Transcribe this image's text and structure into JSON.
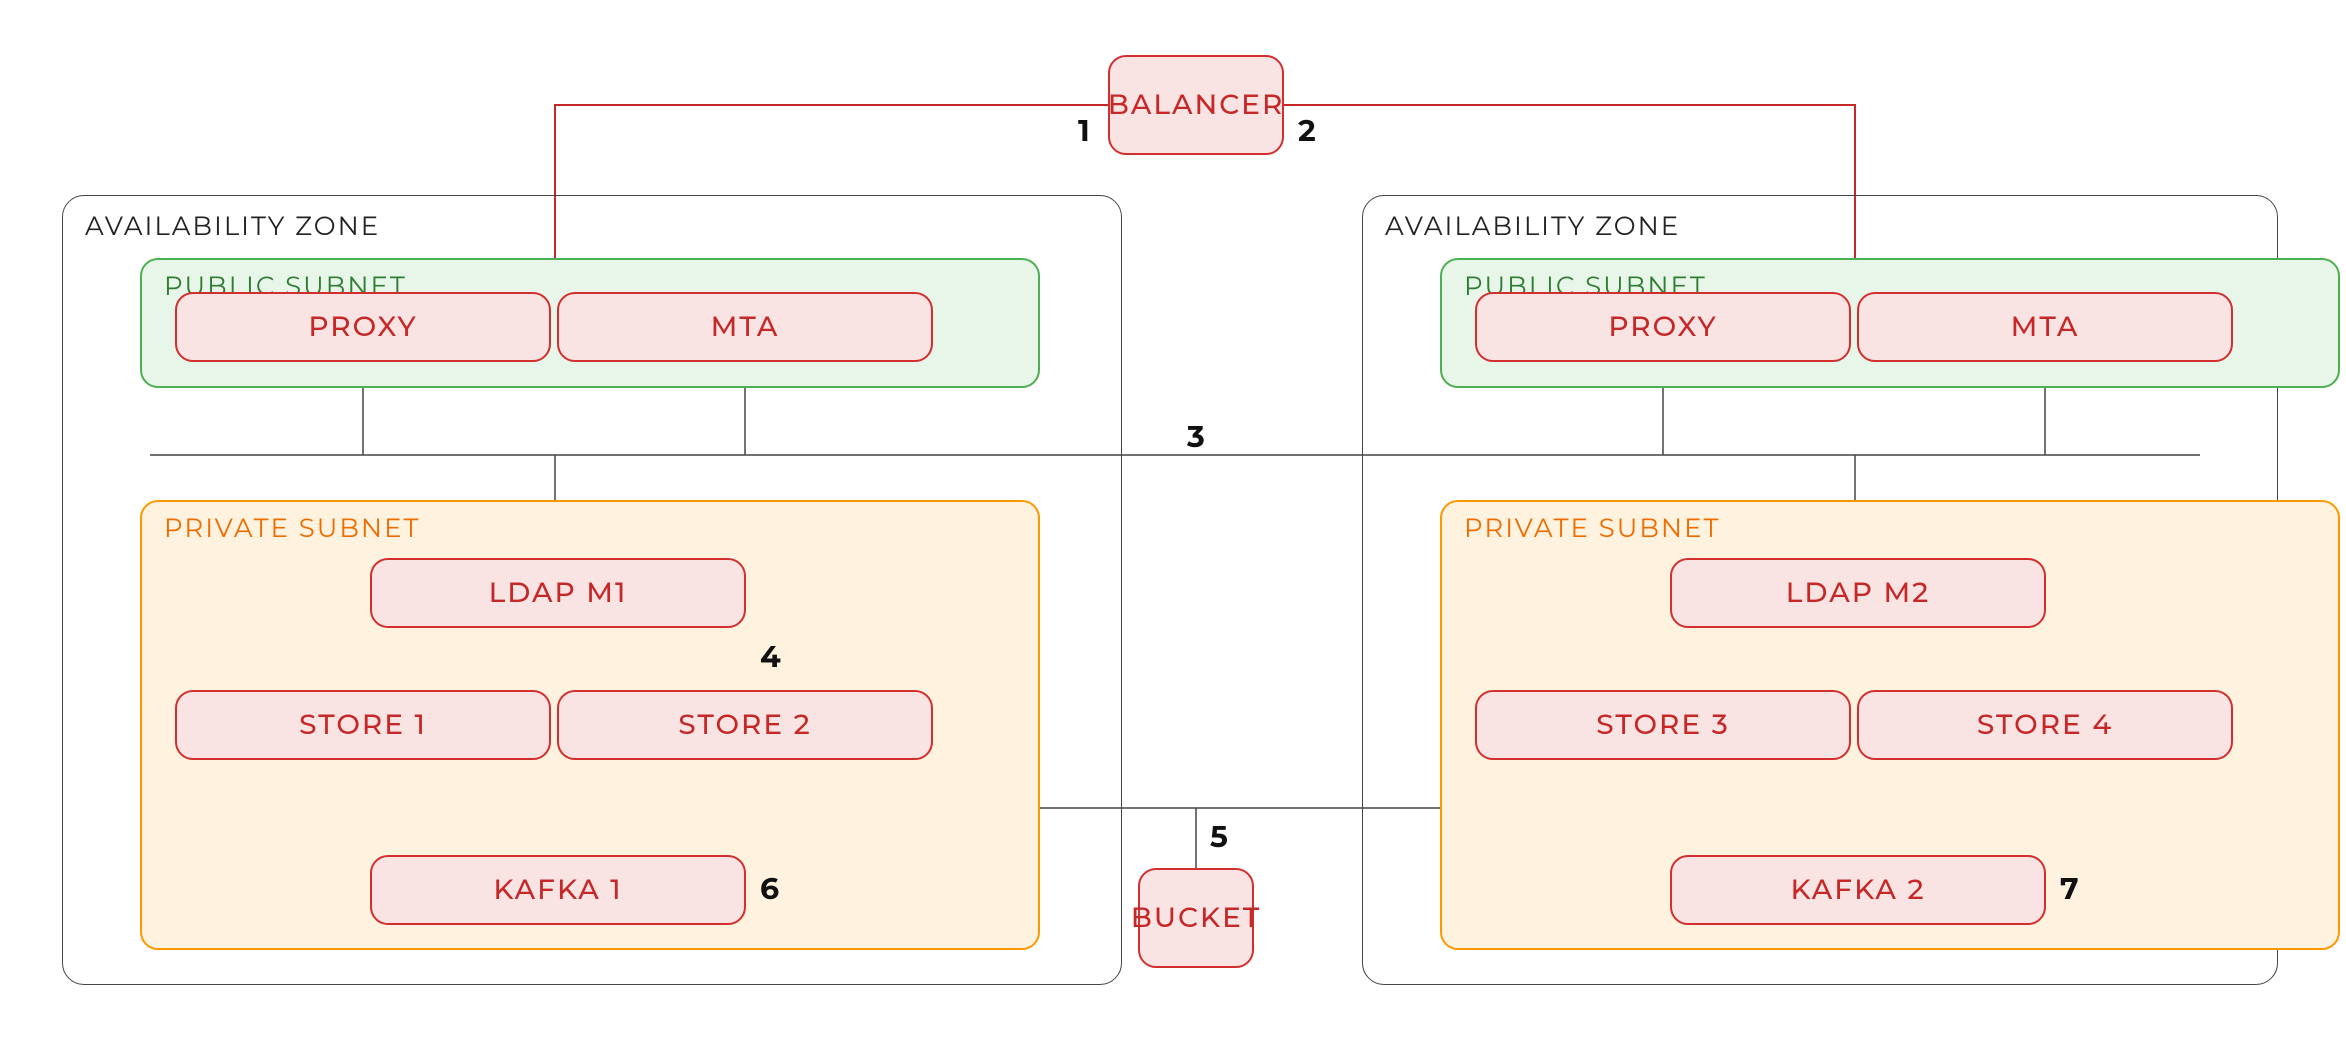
{
  "balancer": "BALANCER",
  "bucket": "BUCKET",
  "zoneTitle": "AVAILABILITY ZONE",
  "publicSubnet": "PUBLIC SUBNET",
  "privateSubnet": "PRIVATE SUBNET",
  "az1": {
    "proxy": "PROXY",
    "mta": "MTA",
    "ldap": "LDAP M1",
    "store1": "STORE 1",
    "store2": "STORE 2",
    "kafka": "KAFKA 1"
  },
  "az2": {
    "proxy": "PROXY",
    "mta": "MTA",
    "ldap": "LDAP M2",
    "store3": "STORE 3",
    "store4": "STORE 4",
    "kafka": "KAFKA 2"
  },
  "labels": {
    "1": "1",
    "2": "2",
    "3": "3",
    "4": "4",
    "5": "5",
    "6": "6",
    "7": "7"
  }
}
